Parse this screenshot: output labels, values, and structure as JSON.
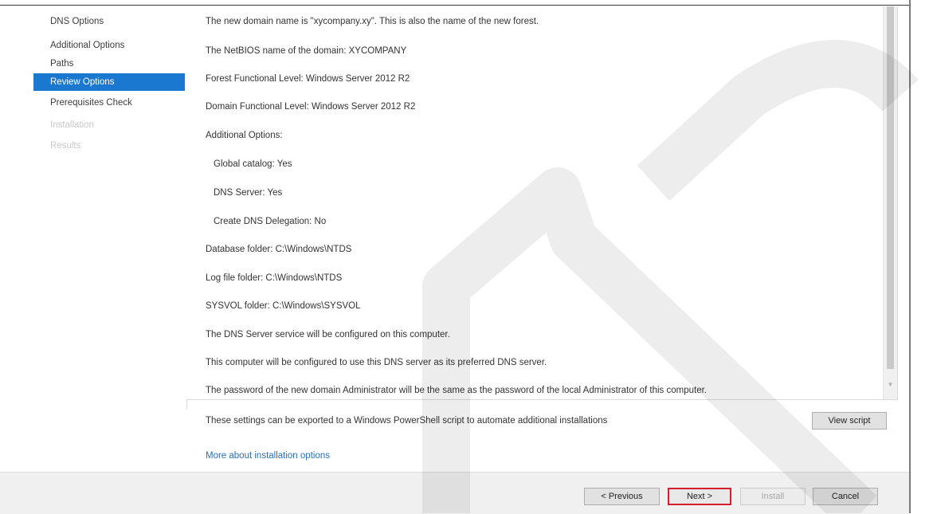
{
  "nav": {
    "items": [
      {
        "label": "DNS Options",
        "state": "normal"
      },
      {
        "label": "Additional Options",
        "state": "normal"
      },
      {
        "label": "Paths",
        "state": "normal"
      },
      {
        "label": "Review Options",
        "state": "active"
      },
      {
        "label": "Prerequisites Check",
        "state": "normal"
      },
      {
        "label": "Installation",
        "state": "disabled"
      },
      {
        "label": "Results",
        "state": "disabled"
      }
    ]
  },
  "review": {
    "lines": [
      "The new domain name is \"xycompany.xy\". This is also the name of the new forest.",
      "The NetBIOS name of the domain: XYCOMPANY",
      "Forest Functional Level: Windows Server 2012 R2",
      "Domain Functional Level: Windows Server 2012 R2",
      "Additional Options:",
      "Global catalog: Yes",
      "DNS Server: Yes",
      "Create DNS Delegation: No",
      "Database folder: C:\\Windows\\NTDS",
      "Log file folder: C:\\Windows\\NTDS",
      "SYSVOL folder: C:\\Windows\\SYSVOL",
      "The DNS Server service will be configured on this computer.",
      "This computer will be configured to use this DNS server as its preferred DNS server.",
      "The password of the new domain Administrator will be the same as the password of the local Administrator of this computer."
    ]
  },
  "export": {
    "text": "These settings can be exported to a Windows PowerShell script to automate additional installations",
    "view_script_label": "View script"
  },
  "more_link": "More about installation options",
  "footer": {
    "previous_label": "< Previous",
    "next_label": "Next >",
    "install_label": "Install",
    "cancel_label": "Cancel"
  },
  "colors": {
    "nav_active_bg": "#1b78d0",
    "link": "#2a6fba",
    "next_highlight": "#d31e2c"
  }
}
